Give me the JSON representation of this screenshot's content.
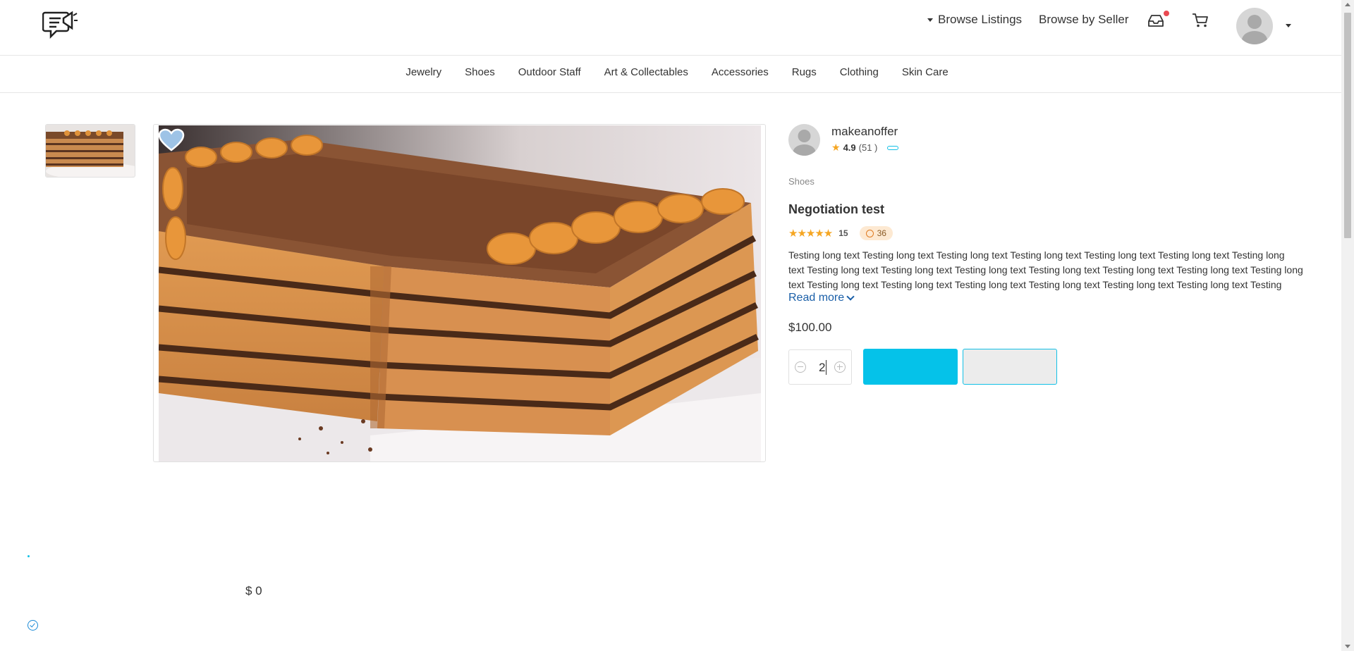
{
  "header": {
    "browse_listings": "Browse Listings",
    "browse_by_seller": "Browse by Seller",
    "icons": [
      "logo-icon",
      "inbox-icon",
      "cart-icon",
      "avatar",
      "dropdown-caret-icon"
    ]
  },
  "categories": [
    "Jewelry",
    "Shoes",
    "Outdoor Staff",
    "Art & Collectables",
    "Accessories",
    "Rugs",
    "Clothing",
    "Skin Care"
  ],
  "seller": {
    "name": "makeanoffer",
    "rating": "4.9",
    "reviews": "(51 )"
  },
  "product": {
    "category": "Shoes",
    "title": "Negotiation test",
    "stars": "★★★★★",
    "review_count": "15",
    "timer_count": "36",
    "description": "Testing long text Testing long text Testing long text Testing long text Testing long text Testing long text Testing long text Testing long text Testing long text Testing long text Testing long text Testing long text Testing long text Testing long text Testing long text Testing long text Testing long text Testing long text Testing long text Testing long text Testing",
    "read_more": "Read more",
    "price": "$100.00",
    "quantity": "2",
    "primary_button_label": "",
    "secondary_button_label": ""
  },
  "footer": {
    "total": "$ 0"
  },
  "colors": {
    "accent": "#05c2e9",
    "star": "#f5a623",
    "link": "#1a5fa8",
    "badge_bg": "#fde9d2"
  }
}
